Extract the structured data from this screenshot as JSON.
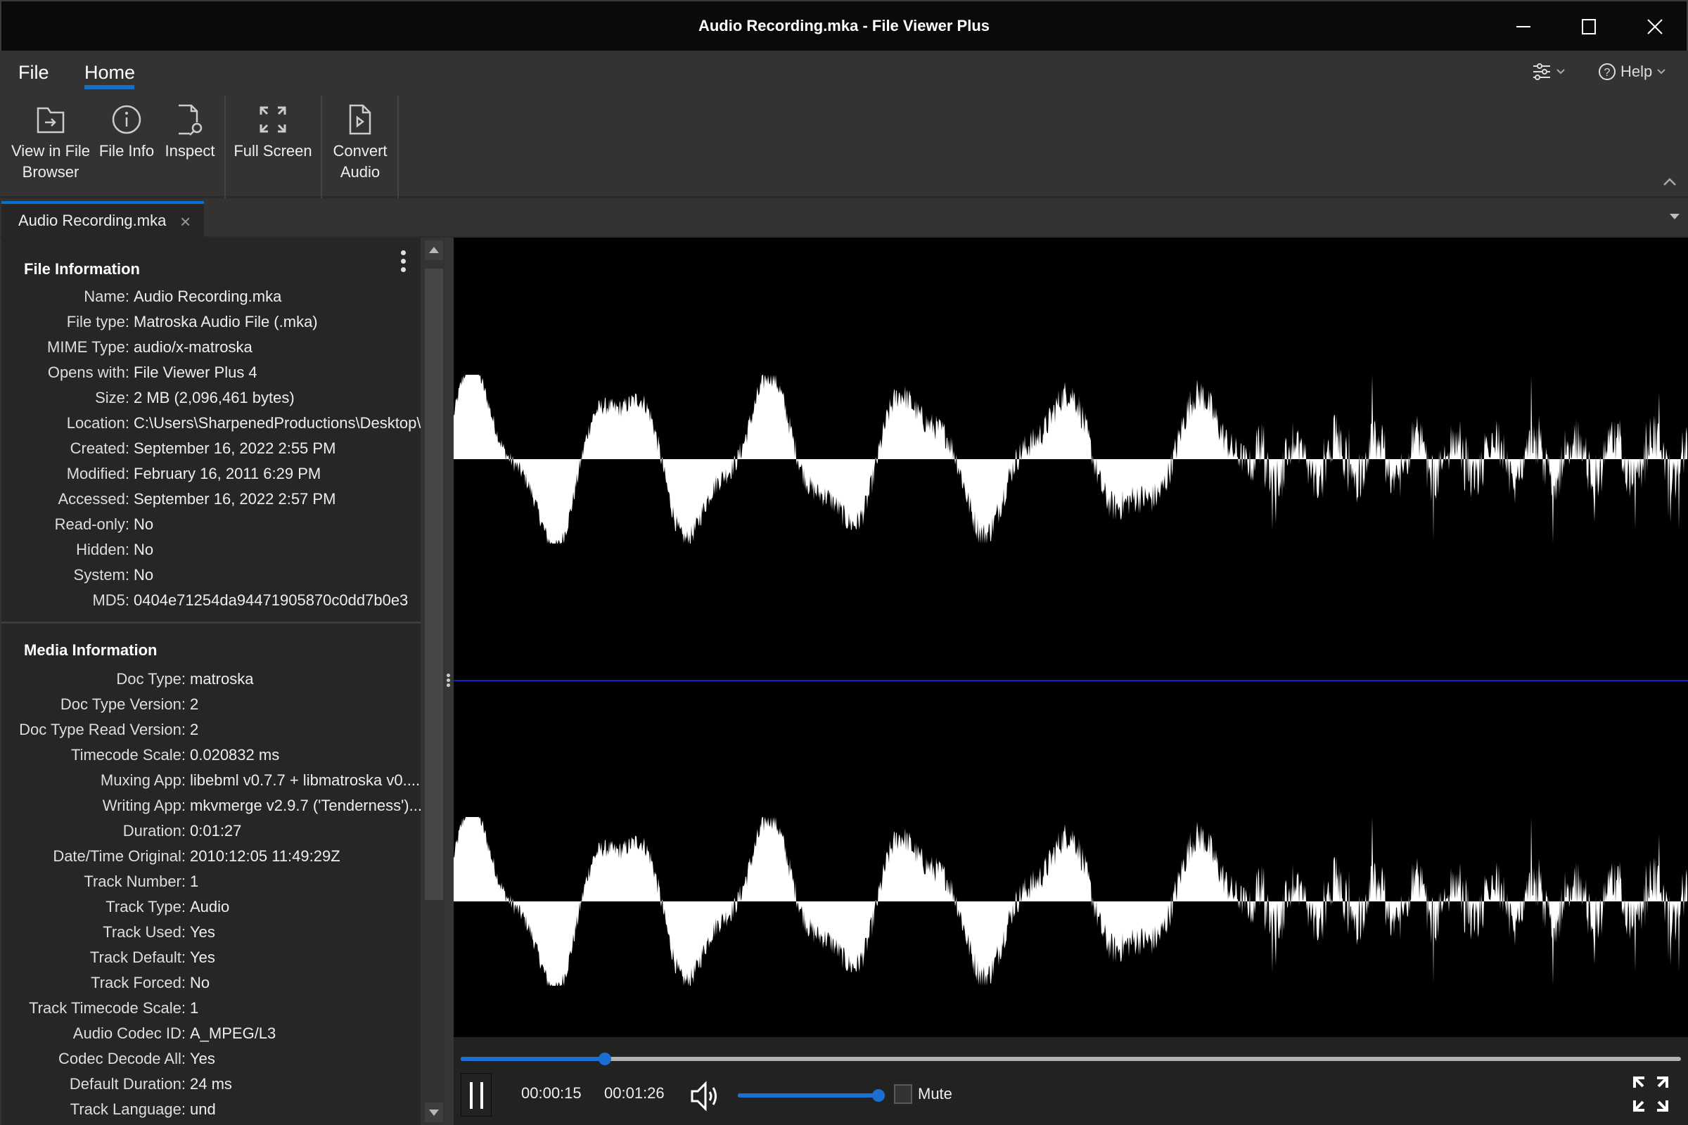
{
  "window": {
    "title": "Audio Recording.mka - File Viewer Plus",
    "controls": [
      "minimize",
      "maximize",
      "close"
    ]
  },
  "menu": {
    "tabs": [
      {
        "label": "File",
        "active": false
      },
      {
        "label": "Home",
        "active": true
      }
    ],
    "settings_icon": "sliders-icon",
    "help_label": "Help"
  },
  "ribbon": {
    "buttons": [
      {
        "label_line1": "View in File",
        "label_line2": "Browser",
        "icon": "folder-arrow-icon"
      },
      {
        "label_line1": "File Info",
        "label_line2": "",
        "icon": "info-icon"
      },
      {
        "label_line1": "Inspect",
        "label_line2": "",
        "icon": "inspect-file-icon"
      },
      {
        "label_line1": "Full Screen",
        "label_line2": "",
        "icon": "fullscreen-icon"
      },
      {
        "label_line1": "Convert",
        "label_line2": "Audio",
        "icon": "convert-audio-icon"
      }
    ]
  },
  "tabs": [
    {
      "label": "Audio Recording.mka",
      "close": "×",
      "active": true
    }
  ],
  "sidebar": {
    "file_info": {
      "title": "File Information",
      "rows": [
        {
          "key": "Name:",
          "value": "Audio Recording.mka"
        },
        {
          "key": "File type:",
          "value": "Matroska Audio File (.mka)"
        },
        {
          "key": "MIME Type:",
          "value": "audio/x-matroska"
        },
        {
          "key": "Opens with:",
          "value": "File Viewer Plus 4"
        },
        {
          "key": "Size:",
          "value": "2 MB (2,096,461 bytes)"
        },
        {
          "key": "Location:",
          "value": "C:\\Users\\SharpenedProductions\\Desktop\\"
        },
        {
          "key": "Created:",
          "value": "September 16, 2022 2:55 PM"
        },
        {
          "key": "Modified:",
          "value": "February 16, 2011 6:29 PM"
        },
        {
          "key": "Accessed:",
          "value": "September 16, 2022 2:57 PM"
        },
        {
          "key": "Read-only:",
          "value": "No"
        },
        {
          "key": "Hidden:",
          "value": "No"
        },
        {
          "key": "System:",
          "value": "No"
        },
        {
          "key": "MD5:",
          "value": "0404e71254da94471905870c0dd7b0e3"
        }
      ]
    },
    "media_info": {
      "title": "Media Information",
      "rows": [
        {
          "key": "Doc Type:",
          "value": "matroska"
        },
        {
          "key": "Doc Type Version:",
          "value": "2"
        },
        {
          "key": "Doc Type Read Version:",
          "value": "2"
        },
        {
          "key": "Timecode Scale:",
          "value": "0.020832 ms"
        },
        {
          "key": "Muxing App:",
          "value": "libebml v0.7.7 + libmatroska v0...."
        },
        {
          "key": "Writing App:",
          "value": "mkvmerge v2.9.7 ('Tenderness')..."
        },
        {
          "key": "Duration:",
          "value": "0:01:27"
        },
        {
          "key": "Date/Time Original:",
          "value": "2010:12:05 11:49:29Z"
        },
        {
          "key": "Track Number:",
          "value": "1"
        },
        {
          "key": "Track Type:",
          "value": "Audio"
        },
        {
          "key": "Track Used:",
          "value": "Yes"
        },
        {
          "key": "Track Default:",
          "value": "Yes"
        },
        {
          "key": "Track Forced:",
          "value": "No"
        },
        {
          "key": "Track Timecode Scale:",
          "value": "1"
        },
        {
          "key": "Audio Codec ID:",
          "value": "A_MPEG/L3"
        },
        {
          "key": "Codec Decode All:",
          "value": "Yes"
        },
        {
          "key": "Default Duration:",
          "value": "24 ms"
        },
        {
          "key": "Track Language:",
          "value": "und"
        }
      ]
    }
  },
  "waveform": {
    "channels": 2,
    "fill_color": "#ffffff",
    "background_color": "#000000",
    "divider_color": "#1a1ad0"
  },
  "player": {
    "current_time": "00:00:15",
    "total_time": "00:01:26",
    "progress_fraction": 0.118,
    "volume_fraction": 1.0,
    "mute_label": "Mute",
    "muted": false,
    "accent_color": "#1b6ed2"
  }
}
